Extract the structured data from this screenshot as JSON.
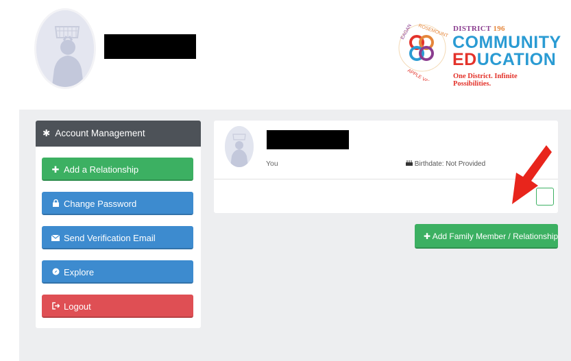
{
  "header": {
    "logo": {
      "district": "DISTRICT",
      "district_num": "196",
      "community": "COMMUNITY",
      "education_ed": "ED",
      "education_rest": "UCATION",
      "tagline": "One District. Infinite Possibilities.",
      "seal_text": "EAGAN · ROSEMOUNT · APPLE VALLEY"
    }
  },
  "sidebar": {
    "title": "Account Management",
    "items": [
      {
        "label": "Add a Relationship",
        "icon": "plus-icon",
        "color": "#3cb062"
      },
      {
        "label": "Change Password",
        "icon": "lock-icon",
        "color": "#3d8bcf"
      },
      {
        "label": "Send Verification Email",
        "icon": "envelope-icon",
        "color": "#3d8bcf"
      },
      {
        "label": "Explore",
        "icon": "compass-icon",
        "color": "#3d8bcf"
      },
      {
        "label": "Logout",
        "icon": "sign-out-icon",
        "color": "#df4f54"
      }
    ]
  },
  "member_card": {
    "relation": "You",
    "birthdate": "Birthdate: Not Provided"
  },
  "add_family_button": "Add Family Member / Relationship",
  "colors": {
    "accent_green": "#3cb062",
    "accent_blue": "#3d8bcf",
    "danger_red": "#df4f54",
    "annotation_arrow": "#e8251c"
  }
}
